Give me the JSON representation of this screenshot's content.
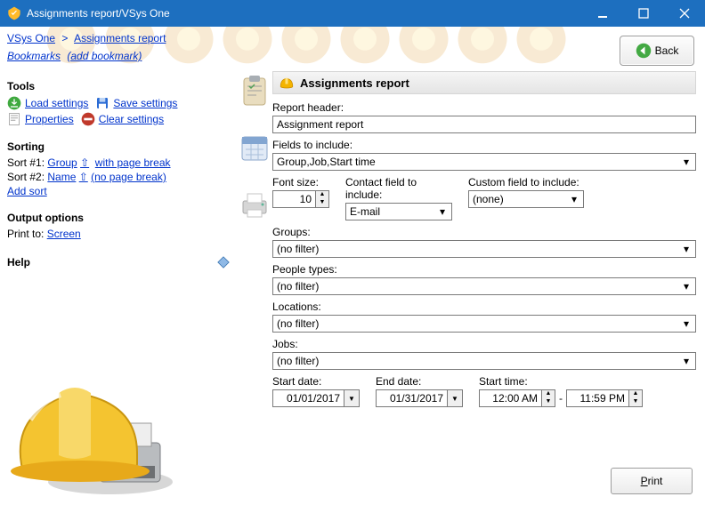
{
  "window": {
    "title": "Assignments report/VSys One"
  },
  "breadcrumb": {
    "root": "VSys One",
    "current": "Assignments report"
  },
  "bookmarks": {
    "label": "Bookmarks",
    "add": "(add bookmark)"
  },
  "back": {
    "label": "Back"
  },
  "sidebar": {
    "tools_hdr": "Tools",
    "load": "Load settings",
    "save": "Save settings",
    "properties": "Properties",
    "clear": "Clear settings",
    "sorting_hdr": "Sorting",
    "sort1_lbl": "Sort #1: ",
    "sort1_field": "Group",
    "sort1_dir": "⇧",
    "sort1_pb": "with page break",
    "sort2_lbl": "Sort #2: ",
    "sort2_field": "Name",
    "sort2_dir": "⇧",
    "sort2_pb": "(no page break)",
    "add_sort": "Add sort",
    "output_hdr": "Output options",
    "print_to_lbl": "Print to: ",
    "print_to_val": "Screen",
    "help_hdr": "Help"
  },
  "pane": {
    "title": "Assignments report",
    "report_header_lbl": "Report header:",
    "report_header_val": "Assignment report",
    "fields_lbl": "Fields to include:",
    "fields_val": "Group,Job,Start time",
    "font_lbl": "Font size:",
    "font_val": "10",
    "contact_lbl": "Contact field to include:",
    "contact_val": "E-mail",
    "custom_lbl": "Custom field to include:",
    "custom_val": "(none)",
    "groups_lbl": "Groups:",
    "groups_val": "(no filter)",
    "people_lbl": "People types:",
    "people_val": "(no filter)",
    "locations_lbl": "Locations:",
    "locations_val": "(no filter)",
    "jobs_lbl": "Jobs:",
    "jobs_val": "(no filter)",
    "start_date_lbl": "Start date:",
    "start_date_val": "01/01/2017",
    "end_date_lbl": "End date:",
    "end_date_val": "01/31/2017",
    "start_time_lbl": "Start time:",
    "start_time_from": "12:00 AM",
    "start_time_to": "11:59 PM"
  },
  "footer": {
    "print": "Print"
  }
}
